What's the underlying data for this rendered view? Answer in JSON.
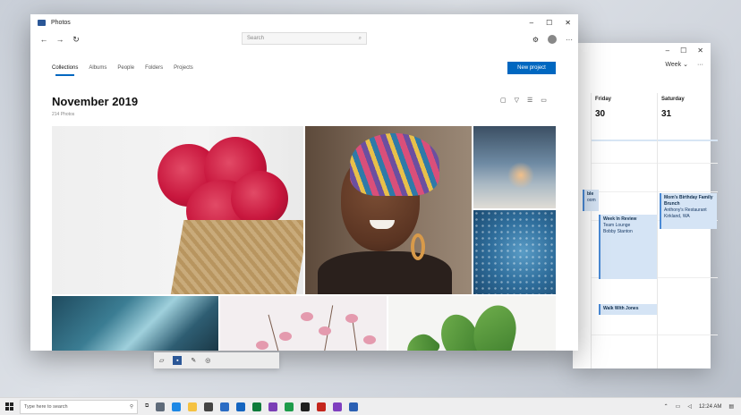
{
  "photos": {
    "title": "Photos",
    "window_controls": [
      "–",
      "☐",
      "✕"
    ],
    "nav": {
      "back": "←",
      "forward": "→",
      "refresh": "↻",
      "search_placeholder": "Search",
      "more": "···"
    },
    "tabs": [
      {
        "label": "Collections",
        "active": true
      },
      {
        "label": "Albums"
      },
      {
        "label": "People"
      },
      {
        "label": "Folders"
      },
      {
        "label": "Projects"
      }
    ],
    "new_project_label": "New project",
    "heading": "November 2019",
    "subheading": "214 Photos"
  },
  "calendar": {
    "window_controls": [
      "–",
      "☐",
      "✕"
    ],
    "view_label": "Week",
    "more": "···",
    "days": [
      {
        "name": "Friday",
        "num": "30"
      },
      {
        "name": "Saturday",
        "num": "31"
      }
    ],
    "events": [
      {
        "title": "ble",
        "detail": "oom"
      },
      {
        "title": "Week In Review",
        "line1": "Team Lounge",
        "line2": "Bobby Stanton"
      },
      {
        "title": "Walk With Jones"
      },
      {
        "title": "Mom's Birthday Family Brunch",
        "line1": "Anthony's Restaurant",
        "line2": "Kirkland, WA"
      }
    ]
  },
  "taskbar": {
    "search_placeholder": "Type here to search",
    "time": "12:24 AM",
    "app_colors": [
      "#5f6b7a",
      "#1e88e5",
      "#f5c242",
      "#444444",
      "#2b6cc4",
      "#1565c0",
      "#0f7b3b",
      "#7b3fb6",
      "#1e9c4b",
      "#202020",
      "#c4261d",
      "#7f3fbf",
      "#2b5fb3"
    ]
  },
  "colors": {
    "accent": "#0067c0"
  }
}
